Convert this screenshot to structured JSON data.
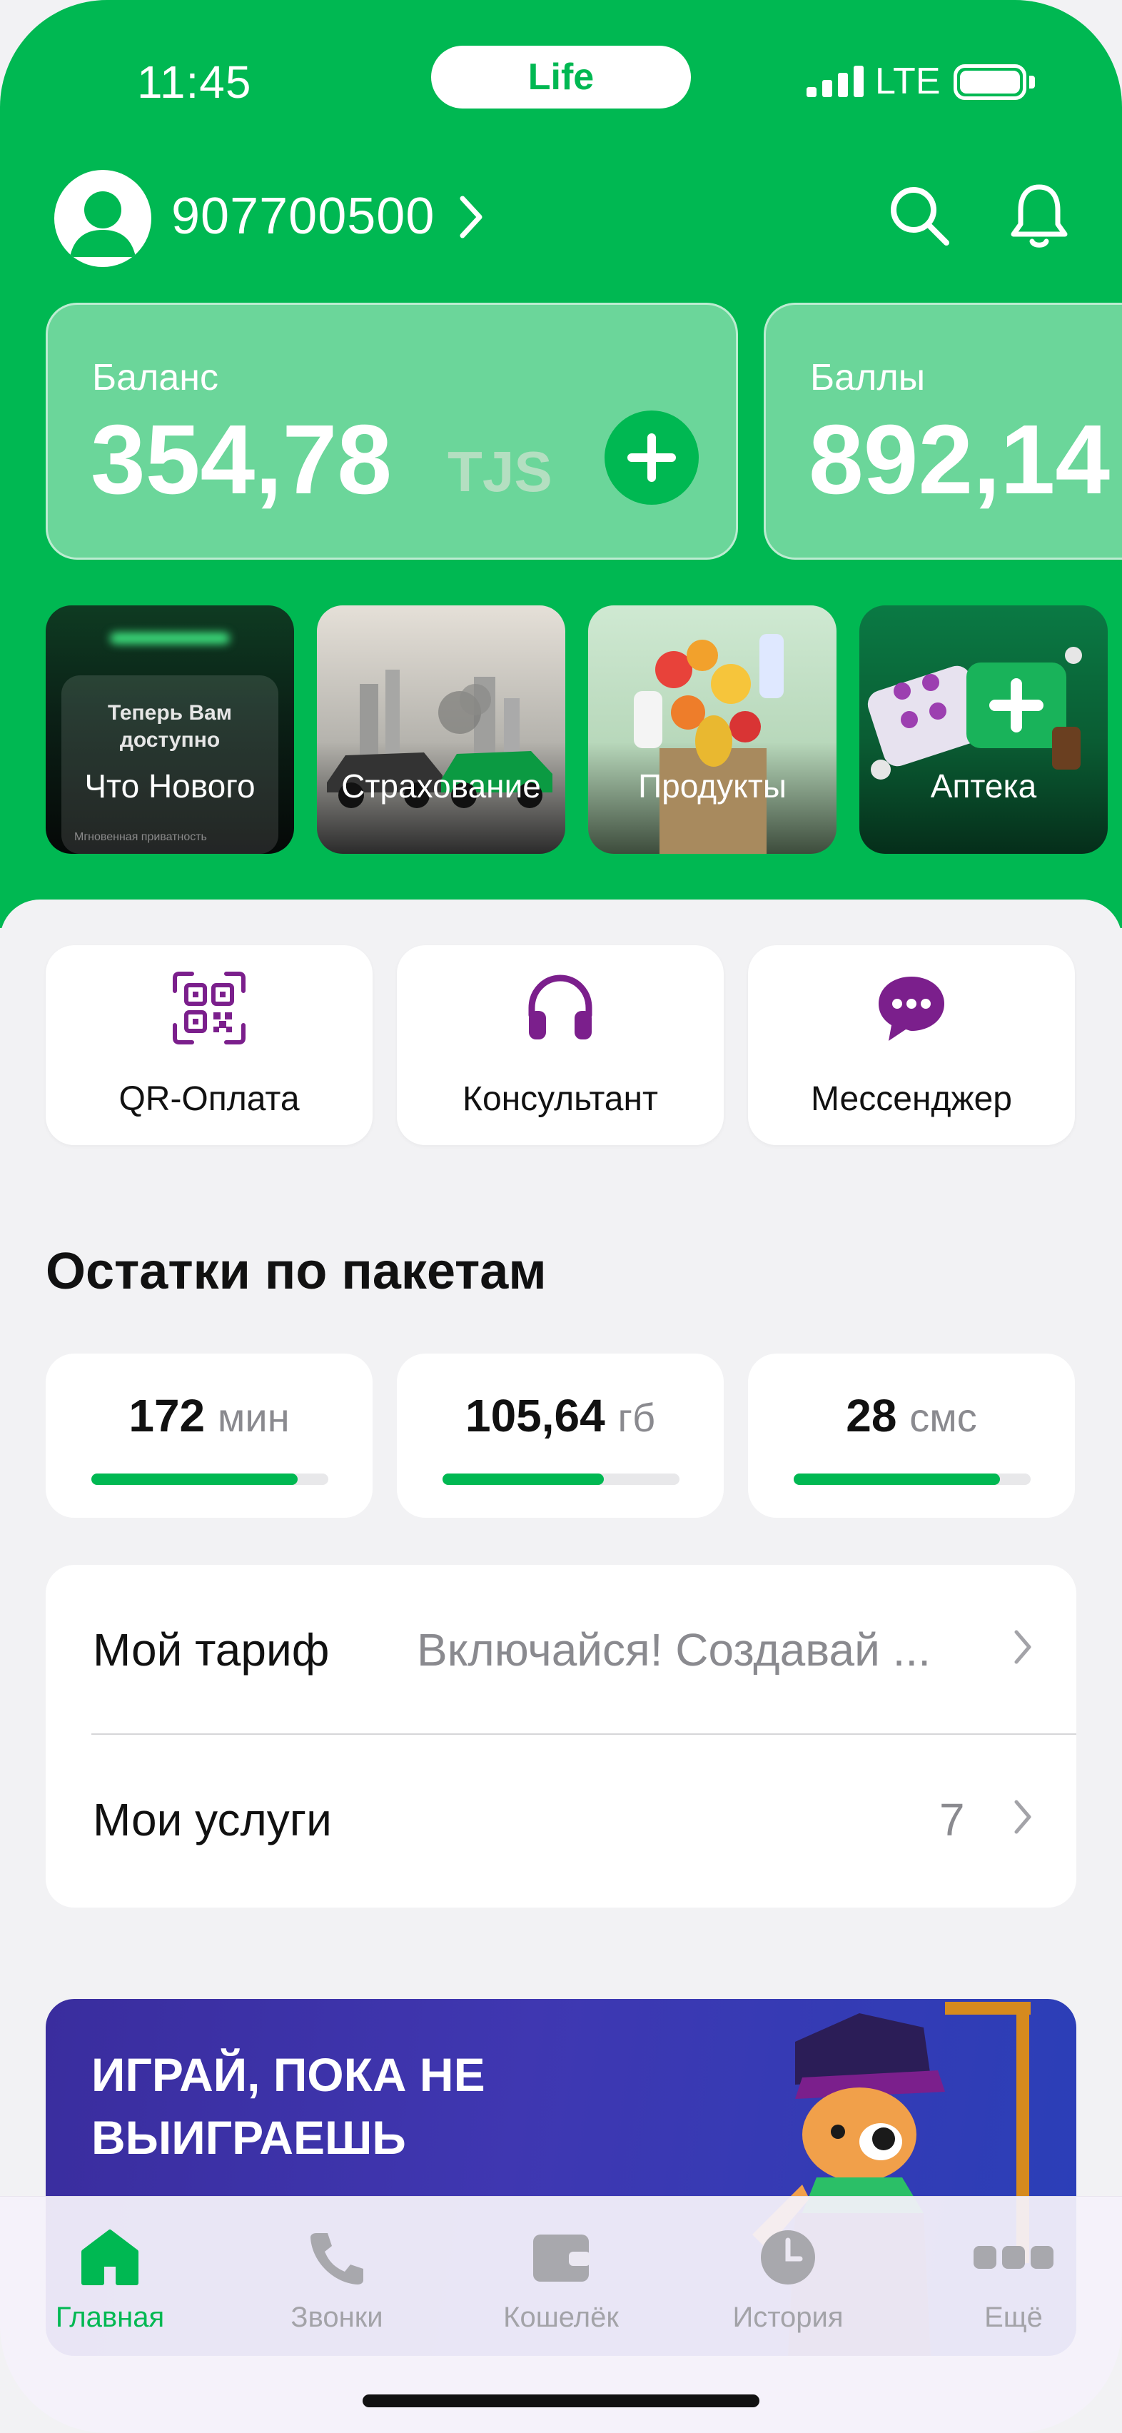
{
  "status_bar": {
    "time": "11:45",
    "carrier_pill": "Life",
    "network": "LTE"
  },
  "header": {
    "phone_number": "907700500"
  },
  "cards": {
    "balance": {
      "label": "Баланс",
      "value": "354,78",
      "unit": "TJS"
    },
    "points": {
      "label": "Баллы",
      "value": "892,14"
    }
  },
  "stories": [
    {
      "title": "Что Нового",
      "preview_line1": "Теперь Вам",
      "preview_line2": "доступно",
      "preview_footer": "Мгновенная приватность"
    },
    {
      "title": "Страхование"
    },
    {
      "title": "Продукты"
    },
    {
      "title": "Аптека"
    }
  ],
  "quick_actions": [
    {
      "label": "QR-Оплата",
      "icon": "qr-code-icon"
    },
    {
      "label": "Консультант",
      "icon": "headphones-icon"
    },
    {
      "label": "Мессенджер",
      "icon": "chat-bubble-icon"
    }
  ],
  "packages": {
    "title": "Остатки по пакетам",
    "items": [
      {
        "value": "172",
        "unit": "мин",
        "fraction": 0.87
      },
      {
        "value": "105,64",
        "unit": "гб",
        "fraction": 0.68
      },
      {
        "value": "28",
        "unit": "смс",
        "fraction": 0.87
      }
    ]
  },
  "list": {
    "tariff": {
      "label": "Мой тариф",
      "value": "Включайся! Создавай ..."
    },
    "services": {
      "label": "Мои услуги",
      "value": "7"
    }
  },
  "banner": {
    "text": "ИГРАЙ, ПОКА НЕ ВЫИГРАЕШЬ"
  },
  "tabs": [
    {
      "label": "Главная",
      "icon": "home-icon",
      "active": true
    },
    {
      "label": "Звонки",
      "icon": "phone-icon",
      "active": false
    },
    {
      "label": "Кошелёк",
      "icon": "wallet-icon",
      "active": false
    },
    {
      "label": "История",
      "icon": "clock-icon",
      "active": false
    },
    {
      "label": "Ещё",
      "icon": "more-icon",
      "active": false
    }
  ],
  "colors": {
    "brand_green": "#00b852",
    "accent_purple": "#7b1f8c",
    "banner_blue": "#3a2d9e"
  }
}
